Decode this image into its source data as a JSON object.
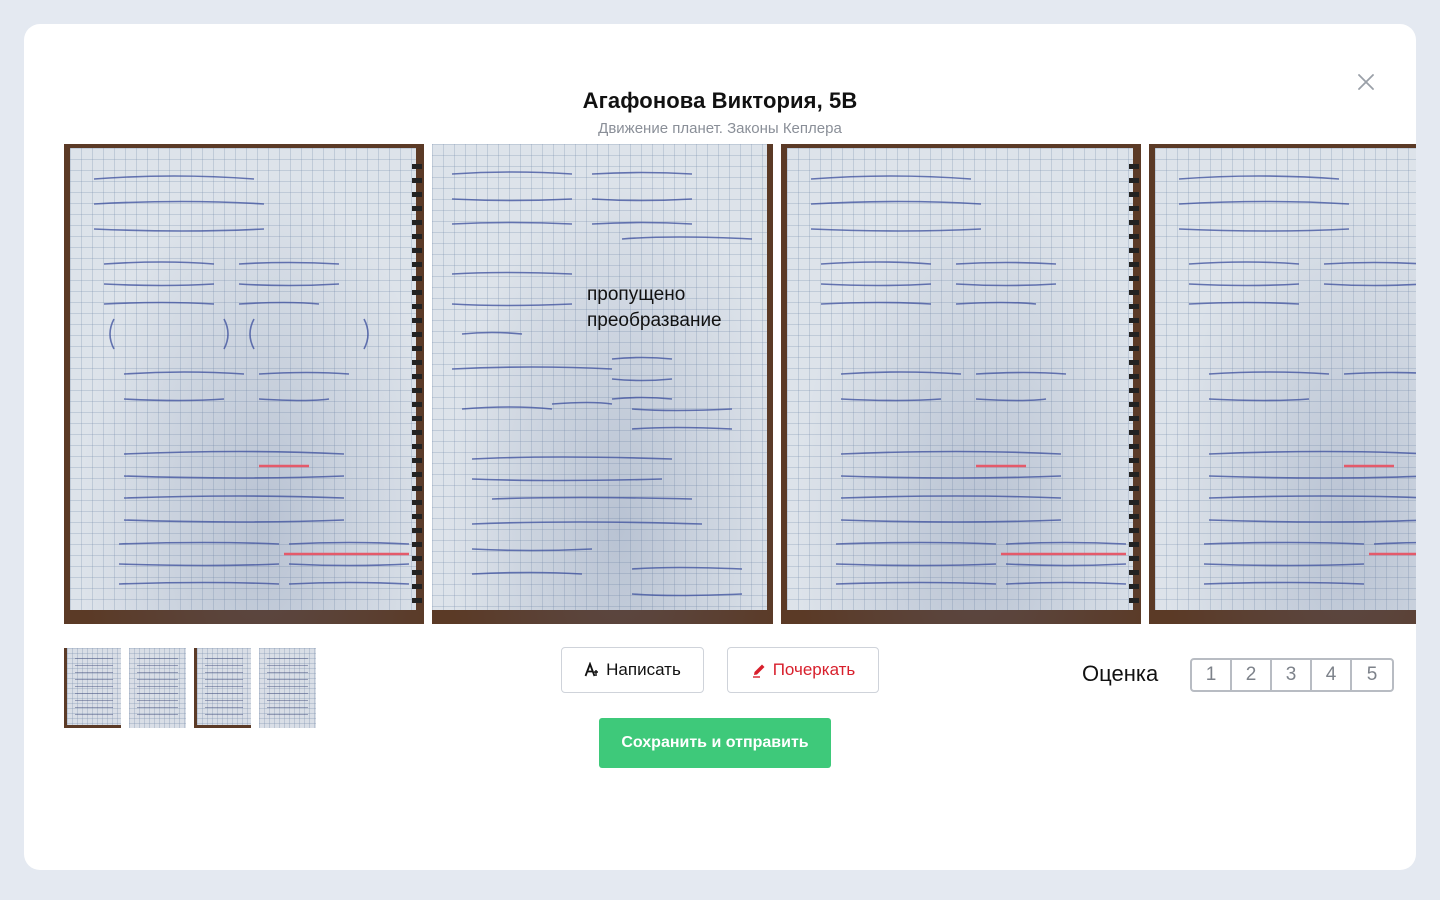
{
  "header": {
    "title": "Агафонова Виктория, 5В",
    "subtitle": "Движение планет. Законы Кеплера"
  },
  "gallery": {
    "annotation_line1": "пропущено",
    "annotation_line2": "преобразвание"
  },
  "actions": {
    "write_label": "Написать",
    "cross_label": "Почеркать",
    "save_label": "Сохранить и отправить"
  },
  "grading": {
    "label": "Оценка",
    "options": [
      "1",
      "2",
      "3",
      "4",
      "5"
    ]
  },
  "colors": {
    "accent_green": "#3ec97a",
    "cross_red": "#d81f2c",
    "background": "#e4e9f1"
  }
}
